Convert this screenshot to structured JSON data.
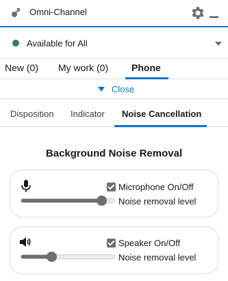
{
  "header": {
    "title": "Omni-Channel",
    "app_icon": "omni-channel-icon",
    "settings_icon": "gear-icon",
    "minimize_icon": "minimize-icon"
  },
  "status": {
    "label": "Available for All",
    "color": "#2e844a",
    "dropdown_icon": "chevron-down-icon"
  },
  "top_tabs": [
    {
      "label": "New (0)",
      "active": false
    },
    {
      "label": "My work (0)",
      "active": false
    },
    {
      "label": "Phone",
      "active": true
    }
  ],
  "close_bar": {
    "label": "Close",
    "icon": "caret-down-icon"
  },
  "sub_tabs": [
    {
      "label": "Disposition",
      "active": false
    },
    {
      "label": "Indicator",
      "active": false
    },
    {
      "label": "Noise Cancellation",
      "active": true
    }
  ],
  "noise": {
    "title": "Background Noise Removal",
    "microphone": {
      "icon": "microphone-icon",
      "toggle_label": "Microphone On/Off",
      "checked": true,
      "level_label": "Noise removal level",
      "level": 0.86
    },
    "speaker": {
      "icon": "speaker-icon",
      "toggle_label": "Speaker On/Off",
      "checked": true,
      "level_label": "Noise removal level",
      "level": 0.32
    }
  },
  "colors": {
    "brand": "#0176d3",
    "status_green": "#2e844a",
    "control_gray": "#706e6b"
  }
}
